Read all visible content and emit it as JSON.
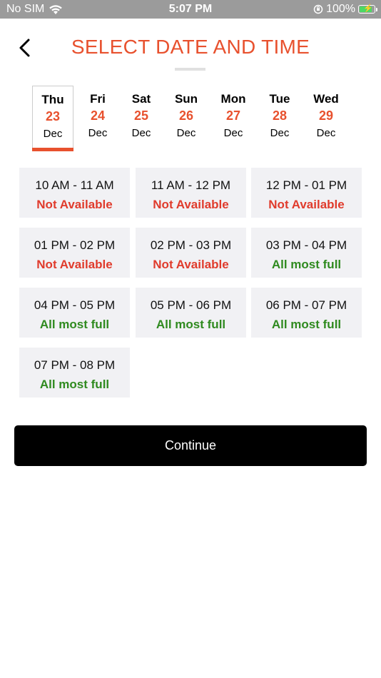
{
  "status_bar": {
    "carrier": "No SIM",
    "time": "5:07 PM",
    "battery_percent": "100%"
  },
  "header": {
    "title": "SELECT DATE AND TIME"
  },
  "dates": [
    {
      "day": "Thu",
      "num": "23",
      "month": "Dec",
      "selected": true
    },
    {
      "day": "Fri",
      "num": "24",
      "month": "Dec",
      "selected": false
    },
    {
      "day": "Sat",
      "num": "25",
      "month": "Dec",
      "selected": false
    },
    {
      "day": "Sun",
      "num": "26",
      "month": "Dec",
      "selected": false
    },
    {
      "day": "Mon",
      "num": "27",
      "month": "Dec",
      "selected": false
    },
    {
      "day": "Tue",
      "num": "28",
      "month": "Dec",
      "selected": false
    },
    {
      "day": "Wed",
      "num": "29",
      "month": "Dec",
      "selected": false
    }
  ],
  "slots": [
    {
      "time": "10 AM - 11 AM",
      "status": "Not Available"
    },
    {
      "time": "11 AM - 12 PM",
      "status": "Not Available"
    },
    {
      "time": "12 PM - 01 PM",
      "status": "Not Available"
    },
    {
      "time": "01 PM - 02 PM",
      "status": "Not Available"
    },
    {
      "time": "02 PM - 03 PM",
      "status": "Not Available"
    },
    {
      "time": "03 PM - 04 PM",
      "status": "All most full"
    },
    {
      "time": "04 PM - 05 PM",
      "status": "All most full"
    },
    {
      "time": "05 PM - 06 PM",
      "status": "All most full"
    },
    {
      "time": "06 PM - 07 PM",
      "status": "All most full"
    },
    {
      "time": "07 PM - 08 PM",
      "status": "All most full"
    }
  ],
  "continue_label": "Continue",
  "colors": {
    "accent": "#e8512e",
    "not_available": "#e03b2c",
    "almost_full": "#2f8a1f"
  }
}
